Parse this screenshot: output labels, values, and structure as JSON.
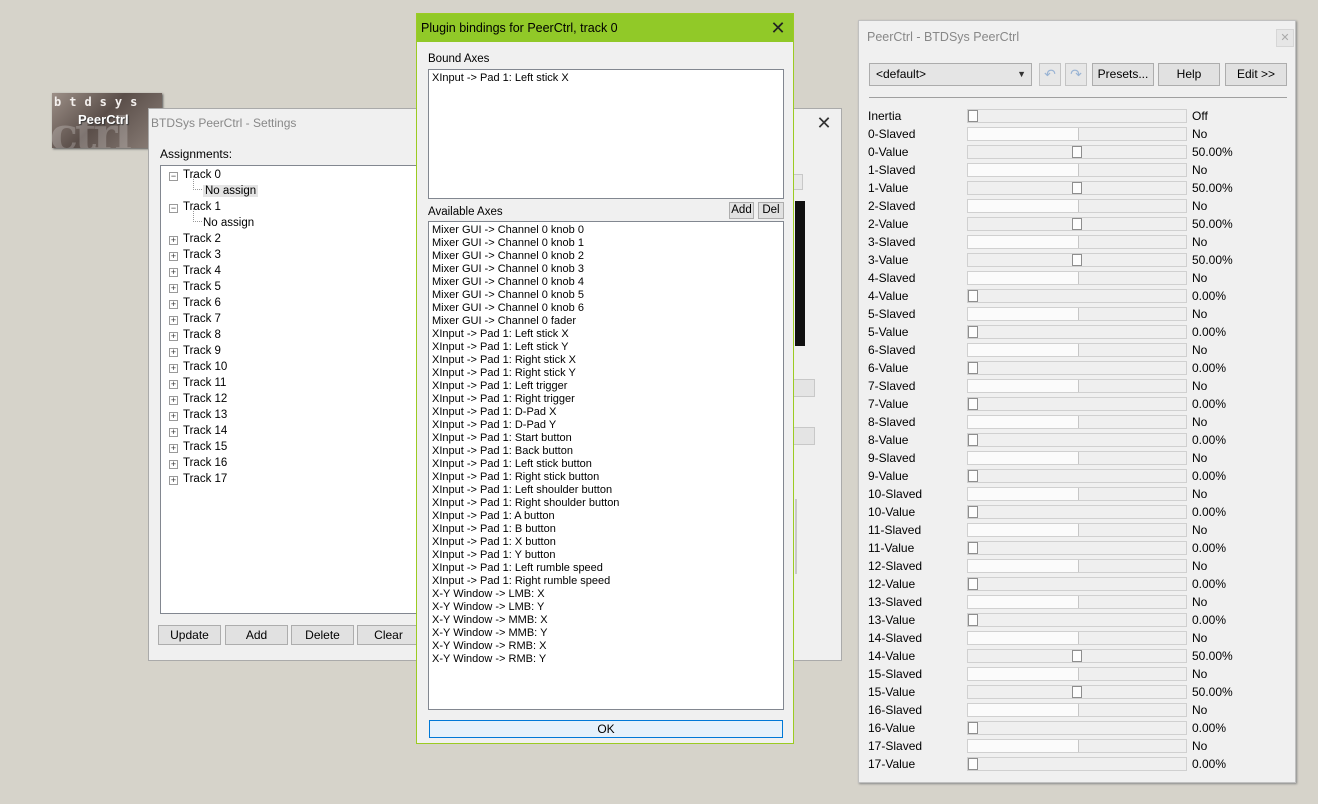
{
  "logo": {
    "line1": "btdsys",
    "line2": "PeerCtrl"
  },
  "settings": {
    "title": "BTDSys PeerCtrl - Settings",
    "assignments_label": "Assignments:",
    "tracks": [
      {
        "label": "Track 0",
        "expanded": true,
        "child": "No assign"
      },
      {
        "label": "Track 1",
        "expanded": true,
        "child": "No assign"
      },
      {
        "label": "Track 2"
      },
      {
        "label": "Track 3"
      },
      {
        "label": "Track 4"
      },
      {
        "label": "Track 5"
      },
      {
        "label": "Track 6"
      },
      {
        "label": "Track 7"
      },
      {
        "label": "Track 8"
      },
      {
        "label": "Track 9"
      },
      {
        "label": "Track 10"
      },
      {
        "label": "Track 11"
      },
      {
        "label": "Track 12"
      },
      {
        "label": "Track 13"
      },
      {
        "label": "Track 14"
      },
      {
        "label": "Track 15"
      },
      {
        "label": "Track 16"
      },
      {
        "label": "Track 17"
      }
    ],
    "buttons": {
      "update": "Update",
      "add": "Add",
      "delete": "Delete",
      "clear": "Clear"
    }
  },
  "plugin": {
    "title": "Plugin bindings for PeerCtrl, track 0",
    "bound_label": "Bound Axes",
    "bound_axes": [
      "XInput -> Pad 1: Left stick X"
    ],
    "available_label": "Available Axes",
    "add_label": "Add",
    "del_label": "Del",
    "available_axes": [
      "Mixer GUI -> Channel 0 knob 0",
      "Mixer GUI -> Channel 0 knob 1",
      "Mixer GUI -> Channel 0 knob 2",
      "Mixer GUI -> Channel 0 knob 3",
      "Mixer GUI -> Channel 0 knob 4",
      "Mixer GUI -> Channel 0 knob 5",
      "Mixer GUI -> Channel 0 knob 6",
      "Mixer GUI -> Channel 0 fader",
      "XInput -> Pad 1: Left stick X",
      "XInput -> Pad 1: Left stick Y",
      "XInput -> Pad 1: Right stick X",
      "XInput -> Pad 1: Right stick Y",
      "XInput -> Pad 1: Left trigger",
      "XInput -> Pad 1: Right trigger",
      "XInput -> Pad 1: D-Pad X",
      "XInput -> Pad 1: D-Pad Y",
      "XInput -> Pad 1: Start button",
      "XInput -> Pad 1: Back button",
      "XInput -> Pad 1: Left stick button",
      "XInput -> Pad 1: Right stick button",
      "XInput -> Pad 1: Left shoulder button",
      "XInput -> Pad 1: Right shoulder button",
      "XInput -> Pad 1: A button",
      "XInput -> Pad 1: B button",
      "XInput -> Pad 1: X button",
      "XInput -> Pad 1: Y button",
      "XInput -> Pad 1: Left rumble speed",
      "XInput -> Pad 1: Right rumble speed",
      "X-Y Window -> LMB: X",
      "X-Y Window -> LMB: Y",
      "X-Y Window -> MMB: X",
      "X-Y Window -> MMB: Y",
      "X-Y Window -> RMB: X",
      "X-Y Window -> RMB: Y"
    ],
    "ok_label": "OK"
  },
  "peer": {
    "title": "PeerCtrl - BTDSys PeerCtrl",
    "preset": "<default>",
    "presets_label": "Presets...",
    "help_label": "Help",
    "edit_label": "Edit >>",
    "params": [
      {
        "name": "Inertia",
        "value": "Off",
        "level": 0.0
      },
      {
        "name": "0-Slaved",
        "value": "No",
        "level": 0.5
      },
      {
        "name": "0-Value",
        "value": "50.00%",
        "level": 0.5
      },
      {
        "name": "1-Slaved",
        "value": "No",
        "level": 0.5
      },
      {
        "name": "1-Value",
        "value": "50.00%",
        "level": 0.5
      },
      {
        "name": "2-Slaved",
        "value": "No",
        "level": 0.5
      },
      {
        "name": "2-Value",
        "value": "50.00%",
        "level": 0.5
      },
      {
        "name": "3-Slaved",
        "value": "No",
        "level": 0.5
      },
      {
        "name": "3-Value",
        "value": "50.00%",
        "level": 0.5
      },
      {
        "name": "4-Slaved",
        "value": "No",
        "level": 0.5
      },
      {
        "name": "4-Value",
        "value": "0.00%",
        "level": 0.0
      },
      {
        "name": "5-Slaved",
        "value": "No",
        "level": 0.5
      },
      {
        "name": "5-Value",
        "value": "0.00%",
        "level": 0.0
      },
      {
        "name": "6-Slaved",
        "value": "No",
        "level": 0.5
      },
      {
        "name": "6-Value",
        "value": "0.00%",
        "level": 0.0
      },
      {
        "name": "7-Slaved",
        "value": "No",
        "level": 0.5
      },
      {
        "name": "7-Value",
        "value": "0.00%",
        "level": 0.0
      },
      {
        "name": "8-Slaved",
        "value": "No",
        "level": 0.5
      },
      {
        "name": "8-Value",
        "value": "0.00%",
        "level": 0.0
      },
      {
        "name": "9-Slaved",
        "value": "No",
        "level": 0.5
      },
      {
        "name": "9-Value",
        "value": "0.00%",
        "level": 0.0
      },
      {
        "name": "10-Slaved",
        "value": "No",
        "level": 0.5
      },
      {
        "name": "10-Value",
        "value": "0.00%",
        "level": 0.0
      },
      {
        "name": "11-Slaved",
        "value": "No",
        "level": 0.5
      },
      {
        "name": "11-Value",
        "value": "0.00%",
        "level": 0.0
      },
      {
        "name": "12-Slaved",
        "value": "No",
        "level": 0.5
      },
      {
        "name": "12-Value",
        "value": "0.00%",
        "level": 0.0
      },
      {
        "name": "13-Slaved",
        "value": "No",
        "level": 0.5
      },
      {
        "name": "13-Value",
        "value": "0.00%",
        "level": 0.0
      },
      {
        "name": "14-Slaved",
        "value": "No",
        "level": 0.5
      },
      {
        "name": "14-Value",
        "value": "50.00%",
        "level": 0.5
      },
      {
        "name": "15-Slaved",
        "value": "No",
        "level": 0.5
      },
      {
        "name": "15-Value",
        "value": "50.00%",
        "level": 0.5
      },
      {
        "name": "16-Slaved",
        "value": "No",
        "level": 0.5
      },
      {
        "name": "16-Value",
        "value": "0.00%",
        "level": 0.0
      },
      {
        "name": "17-Slaved",
        "value": "No",
        "level": 0.5
      },
      {
        "name": "17-Value",
        "value": "0.00%",
        "level": 0.0
      }
    ]
  }
}
